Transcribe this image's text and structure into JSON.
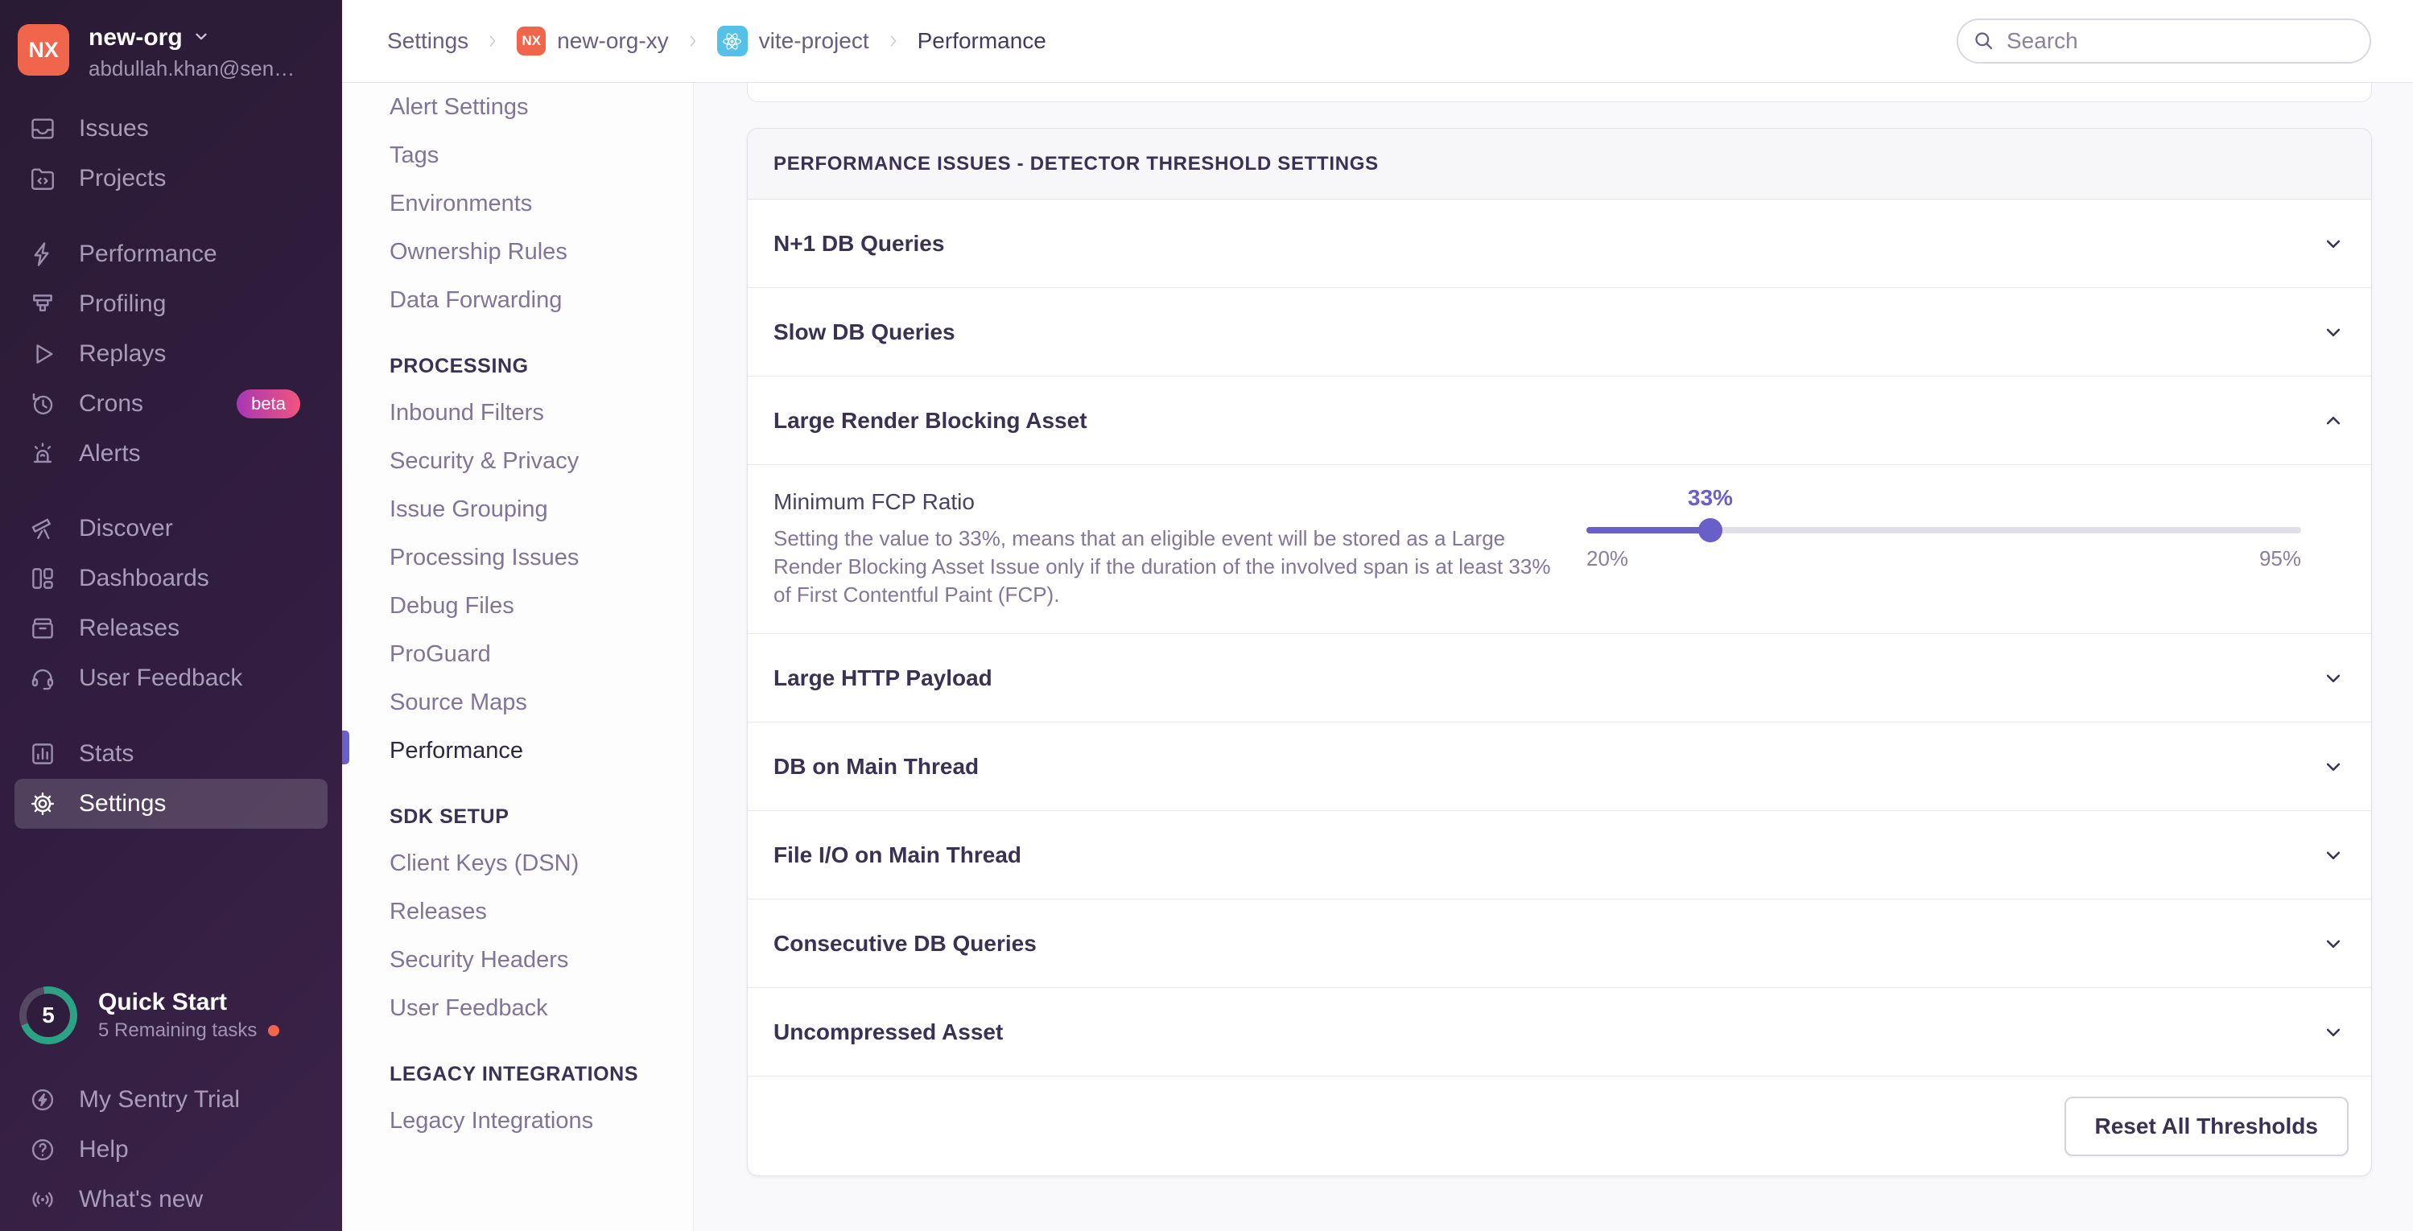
{
  "org": {
    "initials": "NX",
    "name": "new-org",
    "email": "abdullah.khan@sen…"
  },
  "sidebar": {
    "items": [
      {
        "label": "Issues",
        "icon": "issues-icon"
      },
      {
        "label": "Projects",
        "icon": "projects-icon"
      },
      {
        "label": "Performance",
        "icon": "performance-icon"
      },
      {
        "label": "Profiling",
        "icon": "profiling-icon"
      },
      {
        "label": "Replays",
        "icon": "replays-icon"
      },
      {
        "label": "Crons",
        "icon": "crons-icon",
        "badge": "beta"
      },
      {
        "label": "Alerts",
        "icon": "alerts-icon"
      },
      {
        "label": "Discover",
        "icon": "discover-icon"
      },
      {
        "label": "Dashboards",
        "icon": "dashboards-icon"
      },
      {
        "label": "Releases",
        "icon": "releases-icon"
      },
      {
        "label": "User Feedback",
        "icon": "user-feedback-icon"
      },
      {
        "label": "Stats",
        "icon": "stats-icon"
      },
      {
        "label": "Settings",
        "icon": "gear-icon",
        "active": true
      }
    ],
    "quick_start": {
      "count": "5",
      "title": "Quick Start",
      "subtitle": "5 Remaining tasks"
    },
    "footer_items": [
      {
        "label": "My Sentry Trial",
        "icon": "trial-bolt-icon"
      },
      {
        "label": "Help",
        "icon": "help-icon"
      },
      {
        "label": "What's new",
        "icon": "broadcast-icon"
      }
    ]
  },
  "breadcrumb": {
    "items": [
      {
        "label": "Settings"
      },
      {
        "label": "new-org-xy",
        "badge": "NX"
      },
      {
        "label": "vite-project",
        "icon": "react-icon"
      },
      {
        "label": "Performance"
      }
    ]
  },
  "search": {
    "placeholder": "Search"
  },
  "settings_nav": {
    "groups": [
      {
        "items": [
          "Alert Settings",
          "Tags",
          "Environments",
          "Ownership Rules",
          "Data Forwarding"
        ]
      },
      {
        "header": "PROCESSING",
        "items": [
          "Inbound Filters",
          "Security & Privacy",
          "Issue Grouping",
          "Processing Issues",
          "Debug Files",
          "ProGuard",
          "Source Maps",
          "Performance"
        ],
        "active_index": 7
      },
      {
        "header": "SDK SETUP",
        "items": [
          "Client Keys (DSN)",
          "Releases",
          "Security Headers",
          "User Feedback"
        ]
      },
      {
        "header": "LEGACY INTEGRATIONS",
        "items": [
          "Legacy Integrations"
        ]
      }
    ]
  },
  "panel": {
    "title": "PERFORMANCE ISSUES - DETECTOR THRESHOLD SETTINGS",
    "rows": [
      {
        "label": "N+1 DB Queries",
        "expanded": false
      },
      {
        "label": "Slow DB Queries",
        "expanded": false
      },
      {
        "label": "Large Render Blocking Asset",
        "expanded": true
      },
      {
        "label": "Large HTTP Payload",
        "expanded": false
      },
      {
        "label": "DB on Main Thread",
        "expanded": false
      },
      {
        "label": "File I/O on Main Thread",
        "expanded": false
      },
      {
        "label": "Consecutive DB Queries",
        "expanded": false
      },
      {
        "label": "Uncompressed Asset",
        "expanded": false
      }
    ],
    "reset_button": "Reset All Thresholds"
  },
  "threshold_setting": {
    "label": "Minimum FCP Ratio",
    "description": "Setting the value to 33%, means that an eligible event will be stored as a Large Render Blocking Asset Issue only if the duration of the involved span is at least 33% of First Contentful Paint (FCP).",
    "slider": {
      "min": 20,
      "max": 95,
      "value": 33,
      "value_label": "33%",
      "min_label": "20%",
      "max_label": "95%"
    }
  },
  "colors": {
    "accent": "#6a5fc8",
    "org_avatar": "#f2654d",
    "react_badge": "#55c1e8",
    "beta_gradient_start": "#a737b4",
    "beta_gradient_end": "#f0557e",
    "progress_teal": "#2ba185",
    "notification_dot": "#f2654d"
  }
}
